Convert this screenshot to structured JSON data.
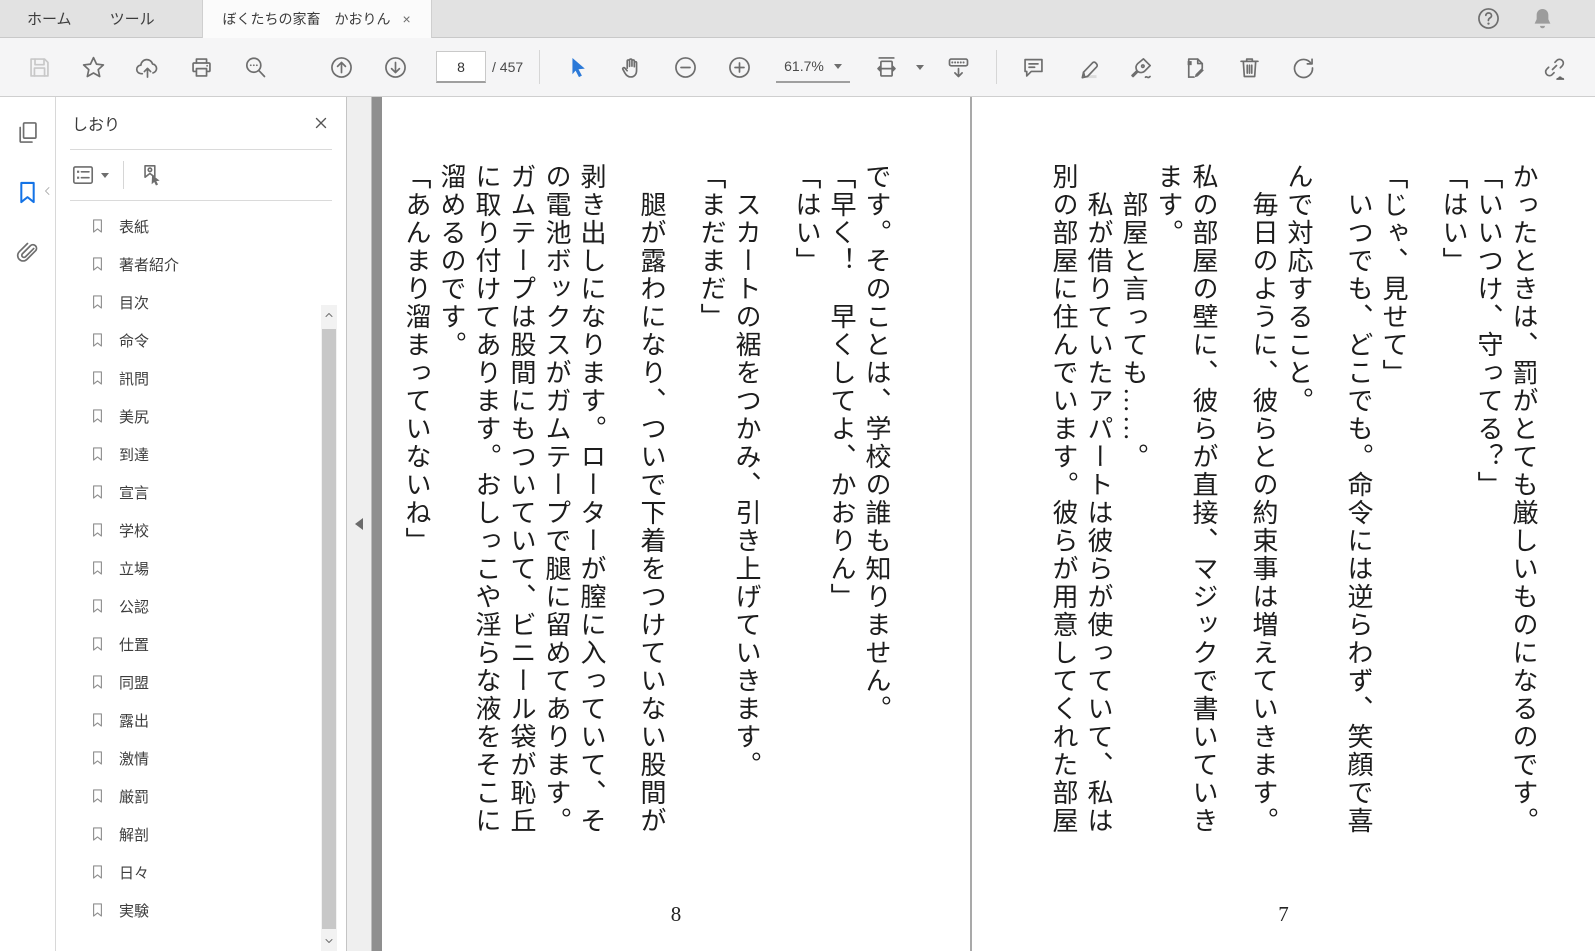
{
  "colors": {
    "accent_blue": "#1473e6",
    "icon_gray": "#6e6e6e",
    "canvas_gray": "#8f8f8f",
    "toolbar_bg": "#f5f5f6",
    "tabbar_bg": "#e2e2e2"
  },
  "tab_bar": {
    "tabs": [
      {
        "id": "home",
        "label": "ホーム"
      },
      {
        "id": "tools",
        "label": "ツール"
      }
    ],
    "document_tab": {
      "title": "ぼくたちの家畜　かおりん",
      "close_label": "×"
    }
  },
  "toolbar": {
    "page_current": "8",
    "page_total_label": "/ 457",
    "zoom_level": "61.7%"
  },
  "bookmarks_panel": {
    "title": "しおり",
    "items": [
      "表紙",
      "著者紹介",
      "目次",
      "命令",
      "訊問",
      "美尻",
      "到達",
      "宣言",
      "学校",
      "立場",
      "公認",
      "仕置",
      "同盟",
      "露出",
      "激情",
      "厳罰",
      "解剖",
      "日々",
      "実験"
    ]
  },
  "document": {
    "left_page": {
      "number": "8",
      "columns": [
        {
          "text": "です。そのことは、学校の誰も知りません。",
          "indent": false,
          "wide": false
        },
        {
          "text": "「早く！　早くしてよ、かおりん」",
          "indent": false,
          "wide": false
        },
        {
          "text": "「はい」",
          "indent": false,
          "wide": false
        },
        {
          "text": "スカートの裾をつかみ、引き上げていきます。",
          "indent": true,
          "wide": true
        },
        {
          "text": "「まだまだ」",
          "indent": false,
          "wide": false
        },
        {
          "text": "腿が露わになり、ついで下着をつけていない股間が",
          "indent": true,
          "wide": true
        },
        {
          "text": "剥き出しになります。ローターが膣に入っていて、そ",
          "indent": false,
          "wide": true
        },
        {
          "text": "の電池ボックスがガムテープで腿に留めてあります。",
          "indent": false,
          "wide": false
        },
        {
          "text": "ガムテープは股間にもついていて、ビニール袋が恥丘",
          "indent": false,
          "wide": false
        },
        {
          "text": "に取り付けてあります。おしっこや淫らな液をそこに",
          "indent": false,
          "wide": false
        },
        {
          "text": "溜めるのです。",
          "indent": false,
          "wide": false
        },
        {
          "text": "「あんまり溜まっていないね」",
          "indent": false,
          "wide": false
        }
      ]
    },
    "right_page": {
      "number": "7",
      "columns": [
        {
          "text": "かったときは、罰がとても厳しいものになるのです。",
          "indent": false,
          "wide": false
        },
        {
          "text": "「いいつけ、守ってる？」",
          "indent": false,
          "wide": false
        },
        {
          "text": "「はい」",
          "indent": false,
          "wide": false
        },
        {
          "text": "「じゃ、見せて」",
          "indent": false,
          "wide": true
        },
        {
          "text": "いつでも、どこでも。命令には逆らわず、笑顔で喜",
          "indent": true,
          "wide": false
        },
        {
          "text": "んで対応すること。",
          "indent": false,
          "wide": true
        },
        {
          "text": "毎日のように、彼らとの約束事は増えていきます。",
          "indent": true,
          "wide": false
        },
        {
          "text": "私の部屋の壁に、彼らが直接、マジックで書いていき",
          "indent": false,
          "wide": true
        },
        {
          "text": "ます。",
          "indent": false,
          "wide": false
        },
        {
          "text": "部屋と言っても……。",
          "indent": true,
          "wide": false
        },
        {
          "text": "私が借りていたアパートは彼らが使っていて、私は",
          "indent": true,
          "wide": false
        },
        {
          "text": "別の部屋に住んでいます。彼らが用意してくれた部屋",
          "indent": false,
          "wide": false
        }
      ]
    }
  }
}
